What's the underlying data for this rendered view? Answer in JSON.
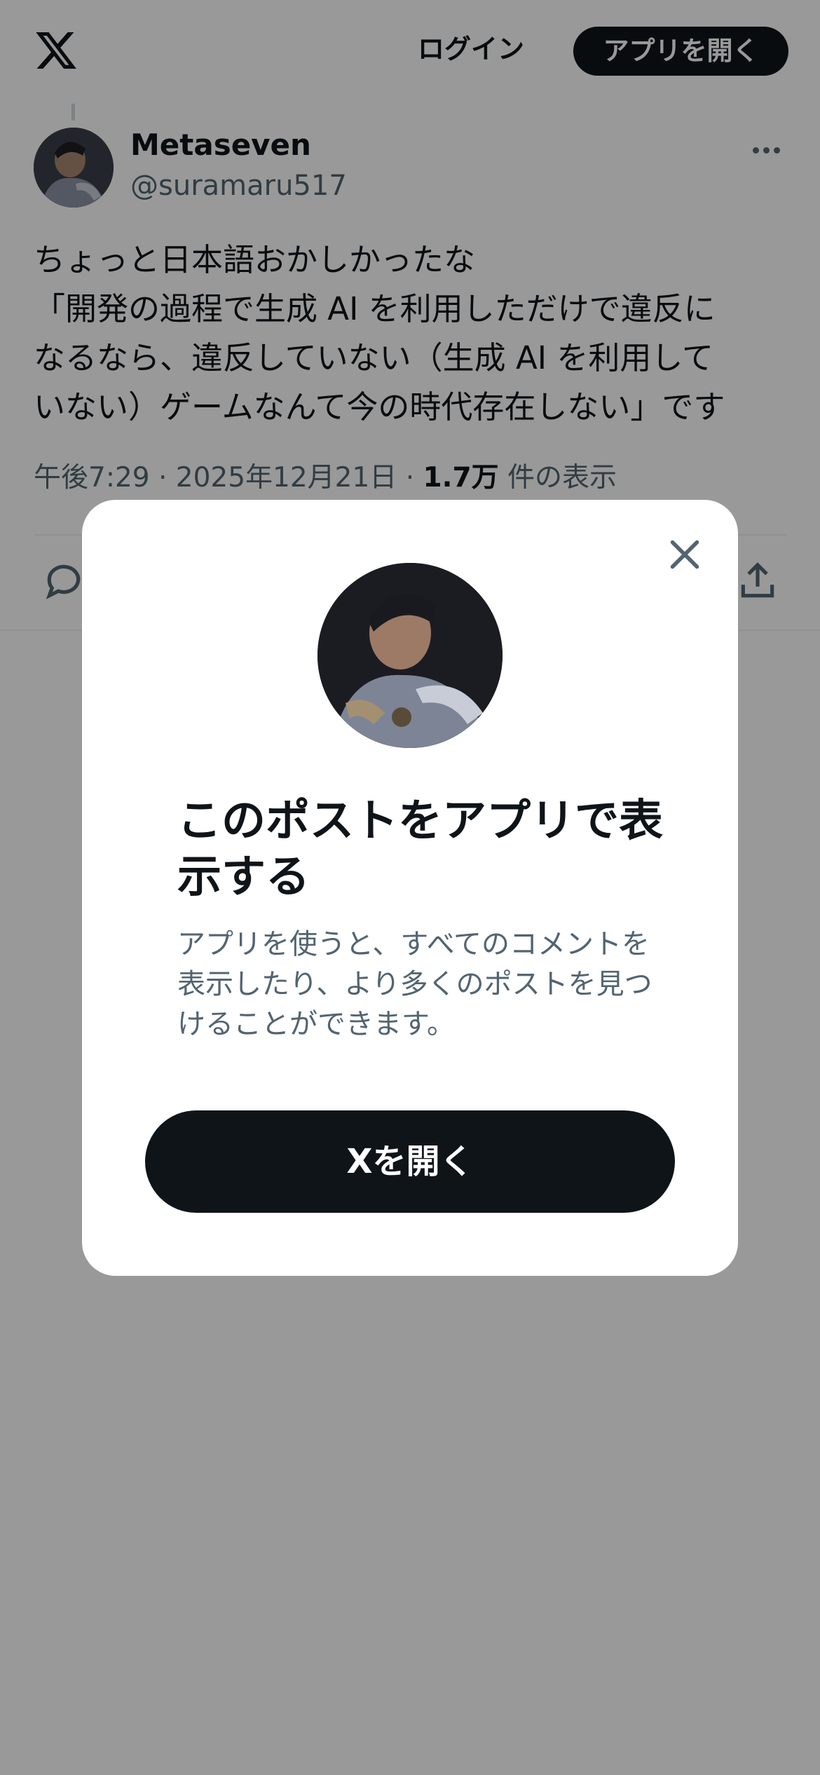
{
  "header": {
    "logo": "x-logo-icon",
    "login_label": "ログイン",
    "open_app_label": "アプリを開く"
  },
  "tweet": {
    "display_name": "Metaseven",
    "handle": "@suramaru517",
    "text": "ちょっと日本語おかしかったな\n「開発の過程で生成 AI を利用しただけで違反に\nなるなら、違反していない（生成 AI を利用して\nいない）ゲームなんて今の時代存在しない」です",
    "time": "午後7:29",
    "date": "2025年12月21日",
    "views_count": "1.7万",
    "views_label": "件の表示",
    "separator": " · "
  },
  "modal": {
    "title": "このポストをアプリで表示する",
    "description": "アプリを使うと、すべてのコメントを表示したり、より多くのポストを見つけることができます。",
    "open_button": "Xを開く"
  },
  "colors": {
    "primary_text": "#0f1419",
    "secondary_text": "#536471",
    "button_bg": "#0f1419",
    "overlay": "rgba(0,0,0,0.4)"
  }
}
